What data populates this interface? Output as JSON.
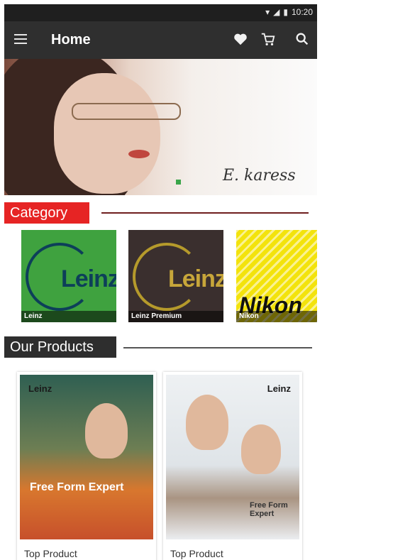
{
  "status_bar": {
    "time": "10:20",
    "icons": [
      "wifi-icon",
      "signal-icon",
      "battery-icon"
    ]
  },
  "app_bar": {
    "title": "Home",
    "actions": [
      "heart-icon",
      "cart-icon",
      "search-icon"
    ]
  },
  "banner": {
    "brand_signature": "E. karess"
  },
  "sections": {
    "category_title": "Category",
    "products_title": "Our Products"
  },
  "categories": [
    {
      "label": "Leinz"
    },
    {
      "label": "Leinz Premium"
    },
    {
      "label": "Nikon"
    }
  ],
  "category_logos": {
    "leinz": "Leinz",
    "nikon": "Nikon"
  },
  "products": [
    {
      "name": "Top Product",
      "tagline": "Free Form Expert",
      "brand": "Leinz"
    },
    {
      "name": "Top Product",
      "tagline": "Free Form Expert",
      "brand": "Leinz"
    }
  ],
  "colors": {
    "category_label": "#e62424",
    "products_label": "#2e2e2e",
    "app_bar": "#2f2f2f"
  }
}
